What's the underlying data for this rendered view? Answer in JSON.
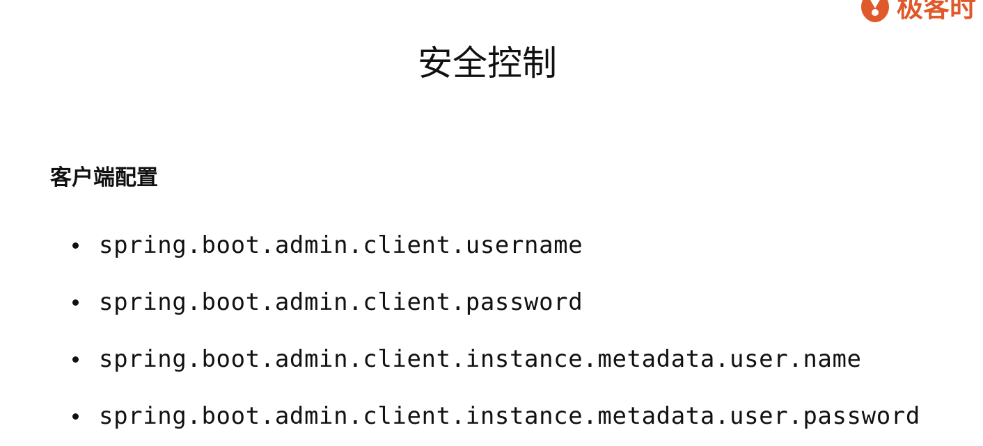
{
  "logo": {
    "text": "极客时",
    "icon": "geektime-logo-icon",
    "color": "#e0592a"
  },
  "slide": {
    "title": "安全控制",
    "section_heading": "客户端配置",
    "bullets": [
      "spring.boot.admin.client.username",
      "spring.boot.admin.client.password",
      "spring.boot.admin.client.instance.metadata.user.name",
      "spring.boot.admin.client.instance.metadata.user.password"
    ]
  }
}
